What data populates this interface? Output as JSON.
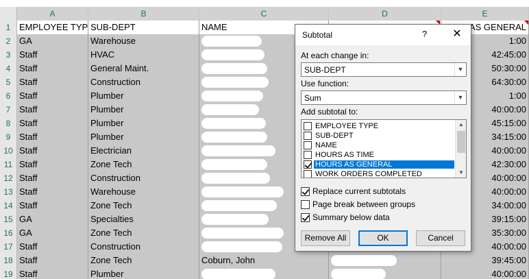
{
  "columns": [
    "A",
    "B",
    "C",
    "D",
    "E"
  ],
  "header_row": {
    "num": "1",
    "employee_type": "EMPLOYEE TYPE",
    "sub_dept": "SUB-DEPT",
    "name": "NAME",
    "hours": "AS GENERAL"
  },
  "rows": [
    {
      "num": "2",
      "type": "GA",
      "dept": "Warehouse",
      "hours": "1:00"
    },
    {
      "num": "3",
      "type": "Staff",
      "dept": "HVAC",
      "hours": "42:45:00"
    },
    {
      "num": "4",
      "type": "Staff",
      "dept": "General Maint.",
      "hours": "50:30:00"
    },
    {
      "num": "5",
      "type": "Staff",
      "dept": "Construction",
      "hours": "64:30:00"
    },
    {
      "num": "6",
      "type": "Staff",
      "dept": "Plumber",
      "hours": "1:00"
    },
    {
      "num": "7",
      "type": "Staff",
      "dept": "Plumber",
      "hours": "40:00:00"
    },
    {
      "num": "8",
      "type": "Staff",
      "dept": "Plumber",
      "hours": "45:15:00"
    },
    {
      "num": "9",
      "type": "Staff",
      "dept": "Plumber",
      "hours": "34:15:00"
    },
    {
      "num": "10",
      "type": "Staff",
      "dept": "Electrician",
      "hours": "40:00:00"
    },
    {
      "num": "11",
      "type": "Staff",
      "dept": "Zone Tech",
      "hours": "42:30:00"
    },
    {
      "num": "12",
      "type": "Staff",
      "dept": "Construction",
      "hours": "40:00:00"
    },
    {
      "num": "13",
      "type": "Staff",
      "dept": "Warehouse",
      "hours": "40:00:00"
    },
    {
      "num": "14",
      "type": "Staff",
      "dept": "Zone Tech",
      "hours": "34:00:00"
    },
    {
      "num": "15",
      "type": "GA",
      "dept": "Specialties",
      "hours": "39:15:00"
    },
    {
      "num": "16",
      "type": "GA",
      "dept": "Zone Tech",
      "hours": "35:30:00"
    },
    {
      "num": "17",
      "type": "Staff",
      "dept": "Construction",
      "hours": "40:00:00"
    },
    {
      "num": "18",
      "type": "Staff",
      "dept": "Zone Tech",
      "name": "Coburn, John",
      "hours": "39:45:00"
    },
    {
      "num": "19",
      "type": "Staff",
      "dept": "Plumber",
      "hours": "40:00:00"
    }
  ],
  "dialog": {
    "title": "Subtotal",
    "help": "?",
    "close": "✕",
    "at_each_change_label": "At each change in:",
    "at_each_change_value": "SUB-DEPT",
    "use_function_label": "Use function:",
    "use_function_value": "Sum",
    "add_subtotal_label": "Add subtotal to:",
    "fields": [
      {
        "label": "EMPLOYEE TYPE",
        "checked": false,
        "selected": false
      },
      {
        "label": "SUB-DEPT",
        "checked": false,
        "selected": false
      },
      {
        "label": "NAME",
        "checked": false,
        "selected": false
      },
      {
        "label": "HOURS AS TIME",
        "checked": false,
        "selected": false
      },
      {
        "label": "HOURS AS GENERAL",
        "checked": true,
        "selected": true
      },
      {
        "label": "WORK ORDERS COMPLETED",
        "checked": false,
        "selected": false
      }
    ],
    "replace_label": "Replace current subtotals",
    "replace_checked": true,
    "page_break_label": "Page break between groups",
    "page_break_checked": false,
    "summary_label": "Summary below data",
    "summary_checked": true,
    "remove_all": "Remove All",
    "ok": "OK",
    "cancel": "Cancel"
  }
}
